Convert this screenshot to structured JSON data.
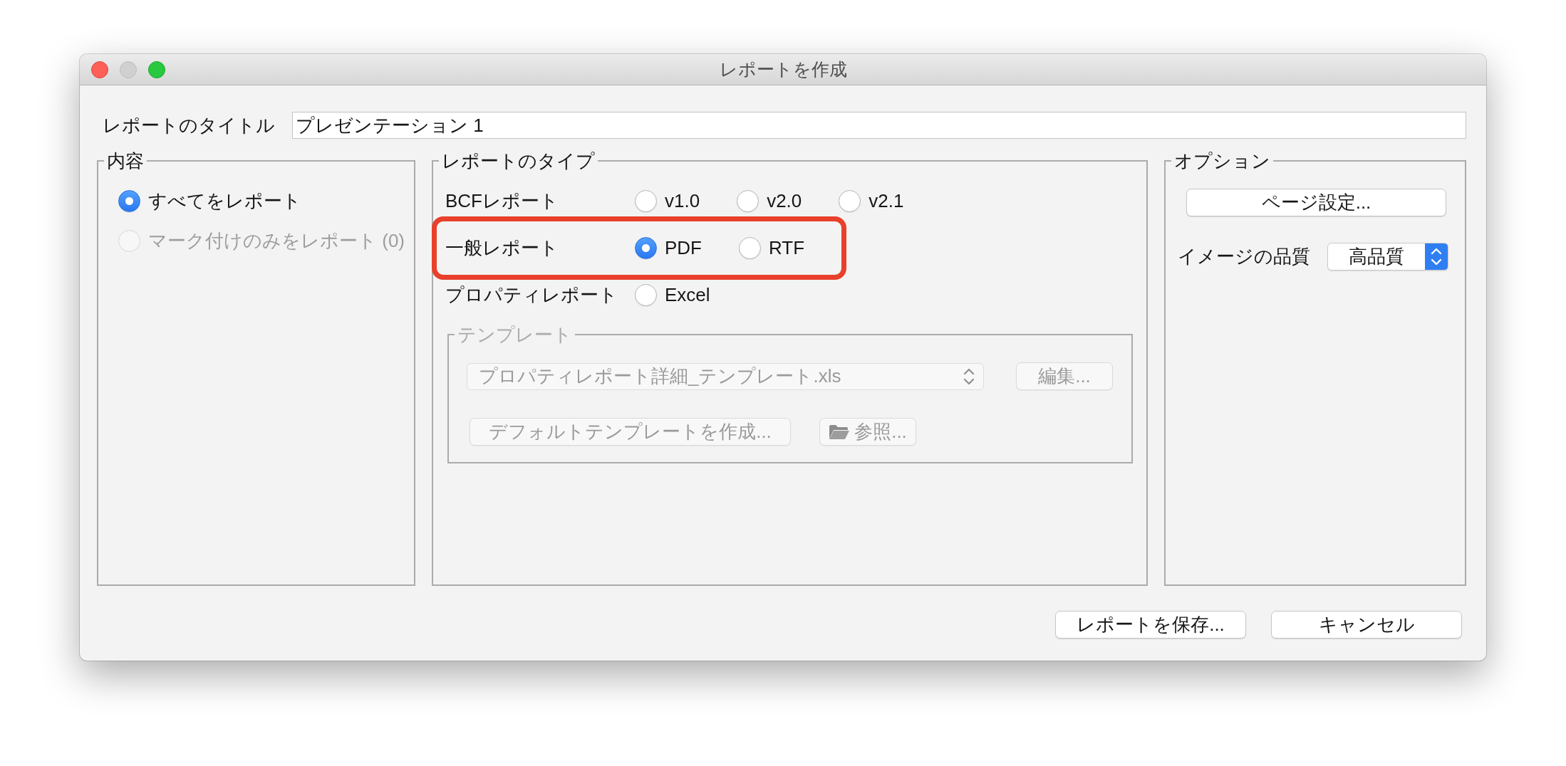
{
  "window": {
    "title": "レポートを作成",
    "controls": [
      {
        "kind": "close",
        "disabled": false
      },
      {
        "kind": "minimize",
        "disabled": true
      },
      {
        "kind": "zoom",
        "disabled": false
      }
    ]
  },
  "report_title": {
    "label": "レポートのタイトル",
    "value": "プレゼンテーション 1"
  },
  "content_group": {
    "title": "内容",
    "options": [
      {
        "label": "すべてをレポート",
        "selected": true,
        "disabled": false
      },
      {
        "label": "マーク付けのみをレポート (0)",
        "selected": false,
        "disabled": true
      }
    ]
  },
  "report_type_group": {
    "title": "レポートのタイプ",
    "rows": [
      {
        "label": "BCFレポート",
        "highlighted": false,
        "options": [
          {
            "label": "v1.0",
            "selected": false
          },
          {
            "label": "v2.0",
            "selected": false
          },
          {
            "label": "v2.1",
            "selected": false
          }
        ]
      },
      {
        "label": "一般レポート",
        "highlighted": true,
        "options": [
          {
            "label": "PDF",
            "selected": true
          },
          {
            "label": "RTF",
            "selected": false
          }
        ]
      },
      {
        "label": "プロパティレポート",
        "highlighted": false,
        "options": [
          {
            "label": "Excel",
            "selected": false
          }
        ]
      }
    ],
    "template": {
      "title": "テンプレート",
      "disabled": true,
      "file": {
        "value": "プロパティレポート詳細_テンプレート.xls"
      },
      "edit_button": "編集...",
      "create_default_button": "デフォルトテンプレートを作成...",
      "browse_button": "参照..."
    }
  },
  "options_group": {
    "title": "オプション",
    "page_setup_button": "ページ設定...",
    "image_quality": {
      "label": "イメージの品質",
      "value": "高品質"
    }
  },
  "buttons": [
    "レポートを保存...",
    "キャンセル"
  ]
}
